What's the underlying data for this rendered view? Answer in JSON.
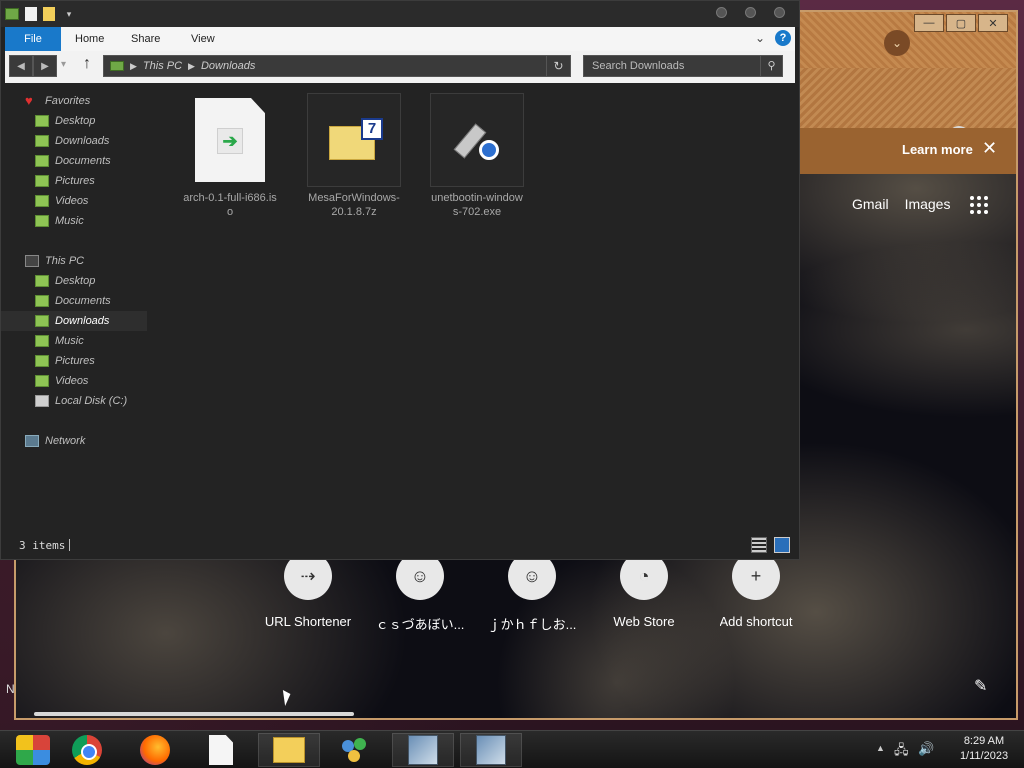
{
  "desktop": {
    "edge_label": "N"
  },
  "chrome": {
    "banner": {
      "learn_more": "Learn more",
      "close": "✕"
    },
    "top_links": {
      "gmail": "Gmail",
      "images": "Images"
    },
    "shortcuts": [
      {
        "label": "URL Shortener",
        "icon": "⇢"
      },
      {
        "label": "ｃｓづあぼい...",
        "icon": "☺"
      },
      {
        "label": "ｊかｈｆしお...",
        "icon": "☺"
      },
      {
        "label": "Web Store",
        "icon": "◔"
      },
      {
        "label": "Add shortcut",
        "icon": "+"
      }
    ],
    "window_buttons": {
      "minimize": "—",
      "maximize": "▢",
      "close": "✕"
    },
    "profile_icon": "⌄"
  },
  "explorer": {
    "ribbon": {
      "file": "File",
      "home": "Home",
      "share": "Share",
      "view": "View",
      "expand": "⌄",
      "help": "?"
    },
    "address": {
      "root": "This PC",
      "folder": "Downloads"
    },
    "search_placeholder": "Search Downloads",
    "nav": {
      "favorites": "Favorites",
      "fav_desktop": "Desktop",
      "fav_downloads": "Downloads",
      "fav_documents": "Documents",
      "fav_pictures": "Pictures",
      "fav_videos": "Videos",
      "fav_music": "Music",
      "this_pc": "This PC",
      "pc_desktop": "Desktop",
      "pc_documents": "Documents",
      "pc_downloads": "Downloads",
      "pc_music": "Music",
      "pc_pictures": "Pictures",
      "pc_videos": "Videos",
      "pc_local_disk": "Local Disk (C:)",
      "network": "Network"
    },
    "files": [
      {
        "name": "arch-0.1-full-i686.iso"
      },
      {
        "name": "MesaForWindows-20.1.8.7z"
      },
      {
        "name": "unetbootin-windows-702.exe"
      }
    ],
    "status": {
      "count": "3 items"
    }
  },
  "taskbar": {
    "clock": {
      "time": "8:29 AM",
      "date": "1/11/2023"
    },
    "tray_arrow": "▲"
  }
}
